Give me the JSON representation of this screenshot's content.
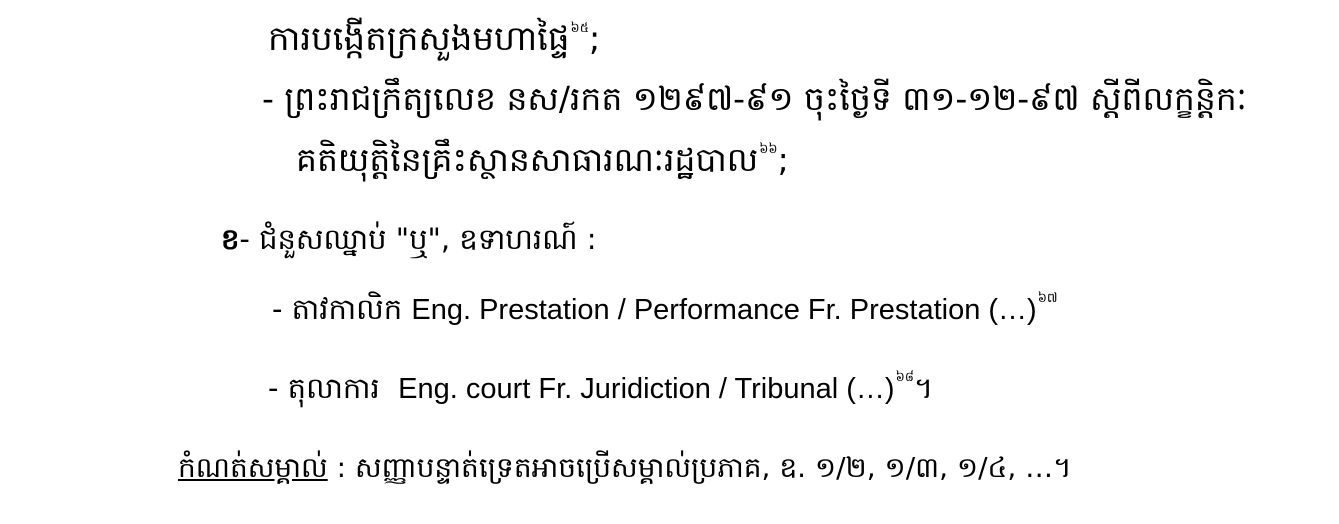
{
  "lines": {
    "l1": {
      "text": "ការបង្កើតក្រសួងមហាផ្ទៃ",
      "footnote": "៦៥",
      "trail": ";"
    },
    "l2": {
      "text": "- ព្រះរាជក្រឹត្យលេខ នស/រកត ១២៩៧-៩១ ចុះថ្ងៃទី ៣១-១២-៩៧ ស្ដីពីលក្ខន្តិកៈ"
    },
    "l3": {
      "text": "គតិយុត្តិនៃគ្រឹះស្ថានសាធារណៈរដ្ឋបាល",
      "footnote": "៦៦",
      "trail": ";"
    },
    "l4": {
      "number": "ខ",
      "text": "- ជំនួសឈ្នាប់ \"ឬ\", ឧទាហរណ៍ :"
    },
    "l5": {
      "khmer": "- តាវកាលិក",
      "latin": "Eng. Prestation / Performance Fr. Prestation (…)",
      "footnote": "៦៧"
    },
    "l6": {
      "khmer": "- តុលាការ",
      "latin": "Eng. court Fr. Juridiction / Tribunal (…)",
      "footnote": "៦៨",
      "trail": "។"
    },
    "l7": {
      "label": "កំណត់សម្គាល់",
      "text": " : សញ្ញាបន្ទាត់ទ្រេតអាចប្រើសម្គាល់ប្រភាគ, ឧ. ១/២, ១/៣, ១/៤, …។"
    }
  }
}
